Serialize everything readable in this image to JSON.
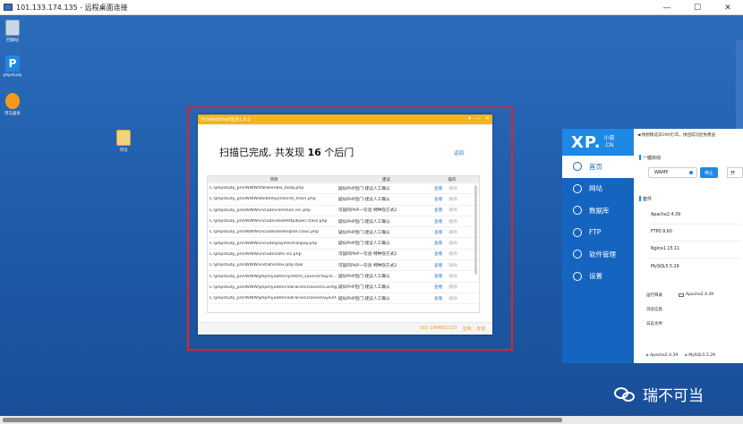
{
  "rdp": {
    "title": "101.133.174.135 - 远程桌面连接",
    "minimize": "—",
    "maximize": "☐",
    "close": "✕"
  },
  "desktop": {
    "icons": [
      {
        "label": "回收站",
        "icon": "recycle-bin-icon",
        "color": "#c9d6e6"
      },
      {
        "label": "phpstudy",
        "icon": "phpstudy-icon",
        "color": "#1e88e5"
      },
      {
        "label": "河马查杀",
        "icon": "hippo-icon",
        "color": "#f39a1d"
      },
      {
        "label": "河马",
        "icon": "folder-icon",
        "color": "#f2d27a"
      }
    ]
  },
  "scanner": {
    "title": "河马WebShell查杀1.8.2",
    "btn_menu": "▾",
    "btn_min": "—",
    "btn_close": "✕",
    "headline_prefix": "扫描已完成, 共发现",
    "headline_count": "16",
    "headline_suffix": "个后门",
    "back_label": "返回",
    "columns": {
      "path": "项目",
      "tip": "建议",
      "op": "操作"
    },
    "view_label": "查看",
    "delete_label": "删除",
    "rows": [
      {
        "path": "C:\\phpstudy_pro\\WWW\\fdedeindex_body.php",
        "tip": "疑似PHP后门-建议人工确认"
      },
      {
        "path": "C:\\phpstudy_pro\\WWW\\dedelmychannel_main.php",
        "tip": "疑似PHP后门-建议人工确认"
      },
      {
        "path": "C:\\phpstudy_pro\\WWW\\include\\common.inc.php",
        "tip": "可疑的PHP一句话-特种隐方式2"
      },
      {
        "path": "C:\\phpstudy_pro\\WWW\\include\\dedehttpdown.class.php",
        "tip": "疑似PHP后门-建议人工确认"
      },
      {
        "path": "C:\\phpstudy_pro\\WWW\\include\\dedesqlite.class.php",
        "tip": "疑似PHP后门-建议人工确认"
      },
      {
        "path": "C:\\phpstudy_pro\\WWW\\include\\payment\\alipay.php",
        "tip": "疑似PHP后门-建议人工确认"
      },
      {
        "path": "C:\\phpstudy_pro\\WWW\\include\\safe.inc.php",
        "tip": "可疑的PHP一句话-特种隐方式2"
      },
      {
        "path": "C:\\phpstudy_pro\\WWW\\install\\index.php.bak",
        "tip": "可疑的PHP一句话-特种隐方式2"
      },
      {
        "path": "C:\\phpstudy_pro\\WWW\\phpmyadmin\\js\\html_sourcecfaq.ts...",
        "tip": "疑似PHP后门-建议人工确认"
      },
      {
        "path": "C:\\phpstudy_pro\\WWW\\phpmyadmin\\libraries\\classes\\Config...",
        "tip": "疑似PHP后门-建议人工确认"
      },
      {
        "path": "C:\\phpstudy_pro\\WWW\\phpmyadmin\\libraries\\classes\\Sysinf...",
        "tip": "疑似PHP后门-建议人工确认"
      }
    ],
    "footer_qq": "QQ: 1494932137",
    "footer_website": "官网",
    "footer_feedback": "反馈"
  },
  "phpstudy": {
    "logo_big": "XP.",
    "logo_small_top": "小皮",
    "logo_small_bottom": ".CN",
    "nav": [
      {
        "label": "首页",
        "name": "nav-home",
        "active": true
      },
      {
        "label": "网站",
        "name": "nav-website",
        "active": false
      },
      {
        "label": "数据库",
        "name": "nav-database",
        "active": false
      },
      {
        "label": "FTP",
        "name": "nav-ftp",
        "active": false
      },
      {
        "label": "软件管理",
        "name": "nav-software",
        "active": false
      },
      {
        "label": "设置",
        "name": "nav-settings",
        "active": false
      }
    ],
    "notice": "畅想精选深199元/年，拼团成功后免费送",
    "one_click_label": "一键启动",
    "wamp_label": "WAMP",
    "stop_label": "停止",
    "open_label": "开",
    "suite_label": "套件",
    "services": [
      "Apache2.4.39",
      "FTP0.9.60",
      "Nginx1.15.11",
      "MySQL5.5.29"
    ],
    "run_dir_label": "运行目录",
    "run_dir_value": "Apache2.4.39",
    "browse_label": "浏览信息",
    "log_label": "日志文件",
    "status": [
      "Apache2.4.39",
      "MySQL5.5.29"
    ]
  },
  "watermark": {
    "text": "瑞不可当"
  }
}
